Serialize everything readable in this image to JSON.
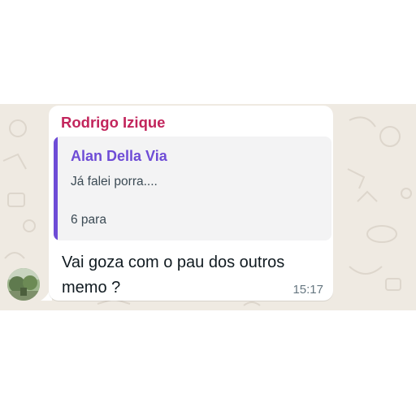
{
  "message": {
    "sender_name": "Rodrigo Izique",
    "quoted": {
      "author": "Alan Della Via",
      "text": "Já falei porra....",
      "meta": "6 para"
    },
    "line1": "Vai goza com o pau dos outros",
    "line2": "memo ?",
    "time": "15:17"
  },
  "colors": {
    "chat_background": "#efeae2",
    "sender_name": "#c2255c",
    "quote_accent": "#6e4cd6",
    "bubble": "#ffffff"
  },
  "icons": [
    "avatar-photo"
  ]
}
